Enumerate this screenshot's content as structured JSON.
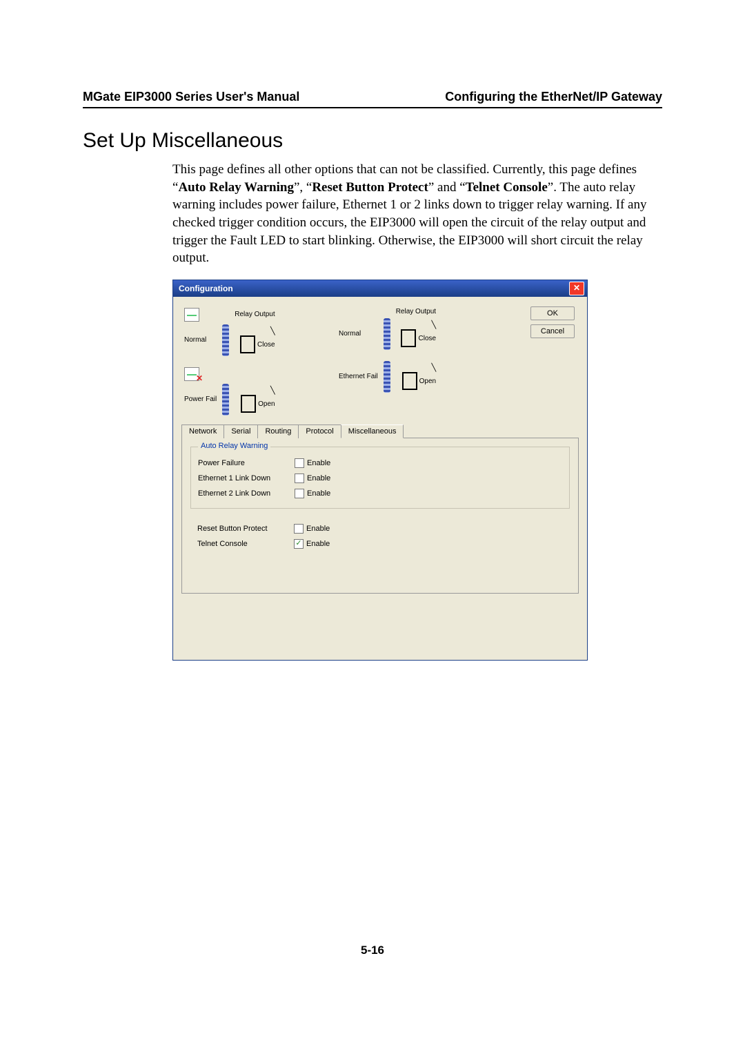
{
  "header": {
    "left": "MGate EIP3000 Series User's Manual",
    "right": "Configuring the EtherNet/IP Gateway"
  },
  "section_title": "Set Up Miscellaneous",
  "para_pre": "This page defines all other options that can not be classified. Currently, this page defines “",
  "para_b1": "Auto Relay Warning",
  "para_mid1": "”, “",
  "para_b2": "Reset Button Protect",
  "para_mid2": "” and “",
  "para_b3": "Telnet Console",
  "para_post": "”. The auto relay warning includes power failure, Ethernet 1 or 2 links down to trigger relay warning. If any checked trigger condition occurs, the EIP3000 will open the circuit of the relay output and trigger the Fault LED to start blinking. Otherwise, the EIP3000 will short circuit the relay output.",
  "dialog": {
    "title": "Configuration",
    "ok_label": "OK",
    "cancel_label": "Cancel",
    "diagram": {
      "normal": "Normal",
      "power_fail": "Power Fail",
      "ethernet_fail": "Ethernet Fail",
      "relay_output": "Relay Output",
      "close": "Close",
      "open": "Open"
    },
    "tabs": [
      "Network",
      "Serial",
      "Routing",
      "Protocol",
      "Miscellaneous"
    ],
    "selected_tab": "Miscellaneous",
    "auto_relay_group": "Auto Relay Warning",
    "rows": {
      "power_failure": "Power Failure",
      "eth1": "Ethernet 1 Link Down",
      "eth2": "Ethernet 2 Link Down",
      "reset": "Reset Button Protect",
      "telnet": "Telnet Console"
    },
    "enable_label": "Enable",
    "checked": {
      "power_failure": false,
      "eth1": false,
      "eth2": false,
      "reset": false,
      "telnet": true
    }
  },
  "page_number": "5-16"
}
